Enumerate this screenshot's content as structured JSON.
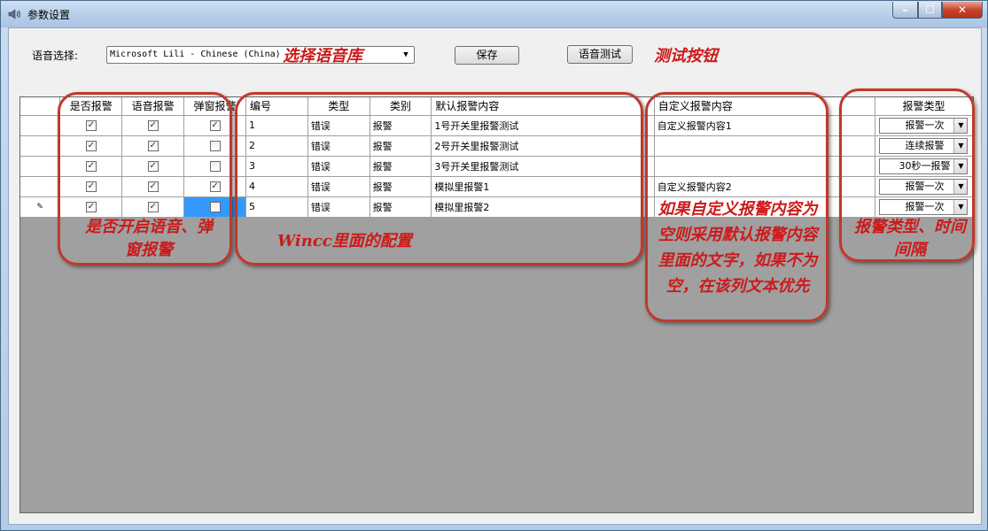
{
  "window": {
    "title": "参数设置"
  },
  "toolbar": {
    "voice_label": "语音选择:",
    "voice_value": "Microsoft Lili - Chinese (China)",
    "save_label": "保存",
    "test_label": "语音测试"
  },
  "annotations": {
    "select_lib": "选择语音库",
    "test_button": "测试按钮",
    "alarm_enable": "是否开启语音、弹窗报警",
    "wincc_config": "Wincc里面的配置",
    "custom_note": "如果自定义报警内容为空则采用默认报警内容里面的文字，如果不为空，在该列文本优先",
    "alarm_type_note": "报警类型、时间间隔"
  },
  "grid": {
    "columns": [
      "是否报警",
      "语音报警",
      "弹窗报警",
      "编号",
      "类型",
      "类别",
      "默认报警内容",
      "自定义报警内容",
      "报警类型"
    ],
    "rows": [
      {
        "alarm": true,
        "voice": true,
        "popup": true,
        "id": "1",
        "type": "错误",
        "category": "报警",
        "default": "1号开关里报警测试",
        "custom": "自定义报警内容1",
        "alarm_type": "报警一次"
      },
      {
        "alarm": true,
        "voice": true,
        "popup": false,
        "id": "2",
        "type": "错误",
        "category": "报警",
        "default": "2号开关里报警测试",
        "custom": "",
        "alarm_type": "连续报警"
      },
      {
        "alarm": true,
        "voice": true,
        "popup": false,
        "id": "3",
        "type": "错误",
        "category": "报警",
        "default": "3号开关里报警测试",
        "custom": "",
        "alarm_type": "30秒一报警"
      },
      {
        "alarm": true,
        "voice": true,
        "popup": true,
        "id": "4",
        "type": "错误",
        "category": "报警",
        "default": "模拟里报警1",
        "custom": "自定义报警内容2",
        "alarm_type": "报警一次"
      },
      {
        "alarm": true,
        "voice": true,
        "popup": false,
        "id": "5",
        "type": "错误",
        "category": "报警",
        "default": "模拟里报警2",
        "custom": "",
        "alarm_type": "报警一次"
      }
    ]
  },
  "colors": {
    "annotation": "#cc1a1a",
    "selection": "#3399ff"
  }
}
